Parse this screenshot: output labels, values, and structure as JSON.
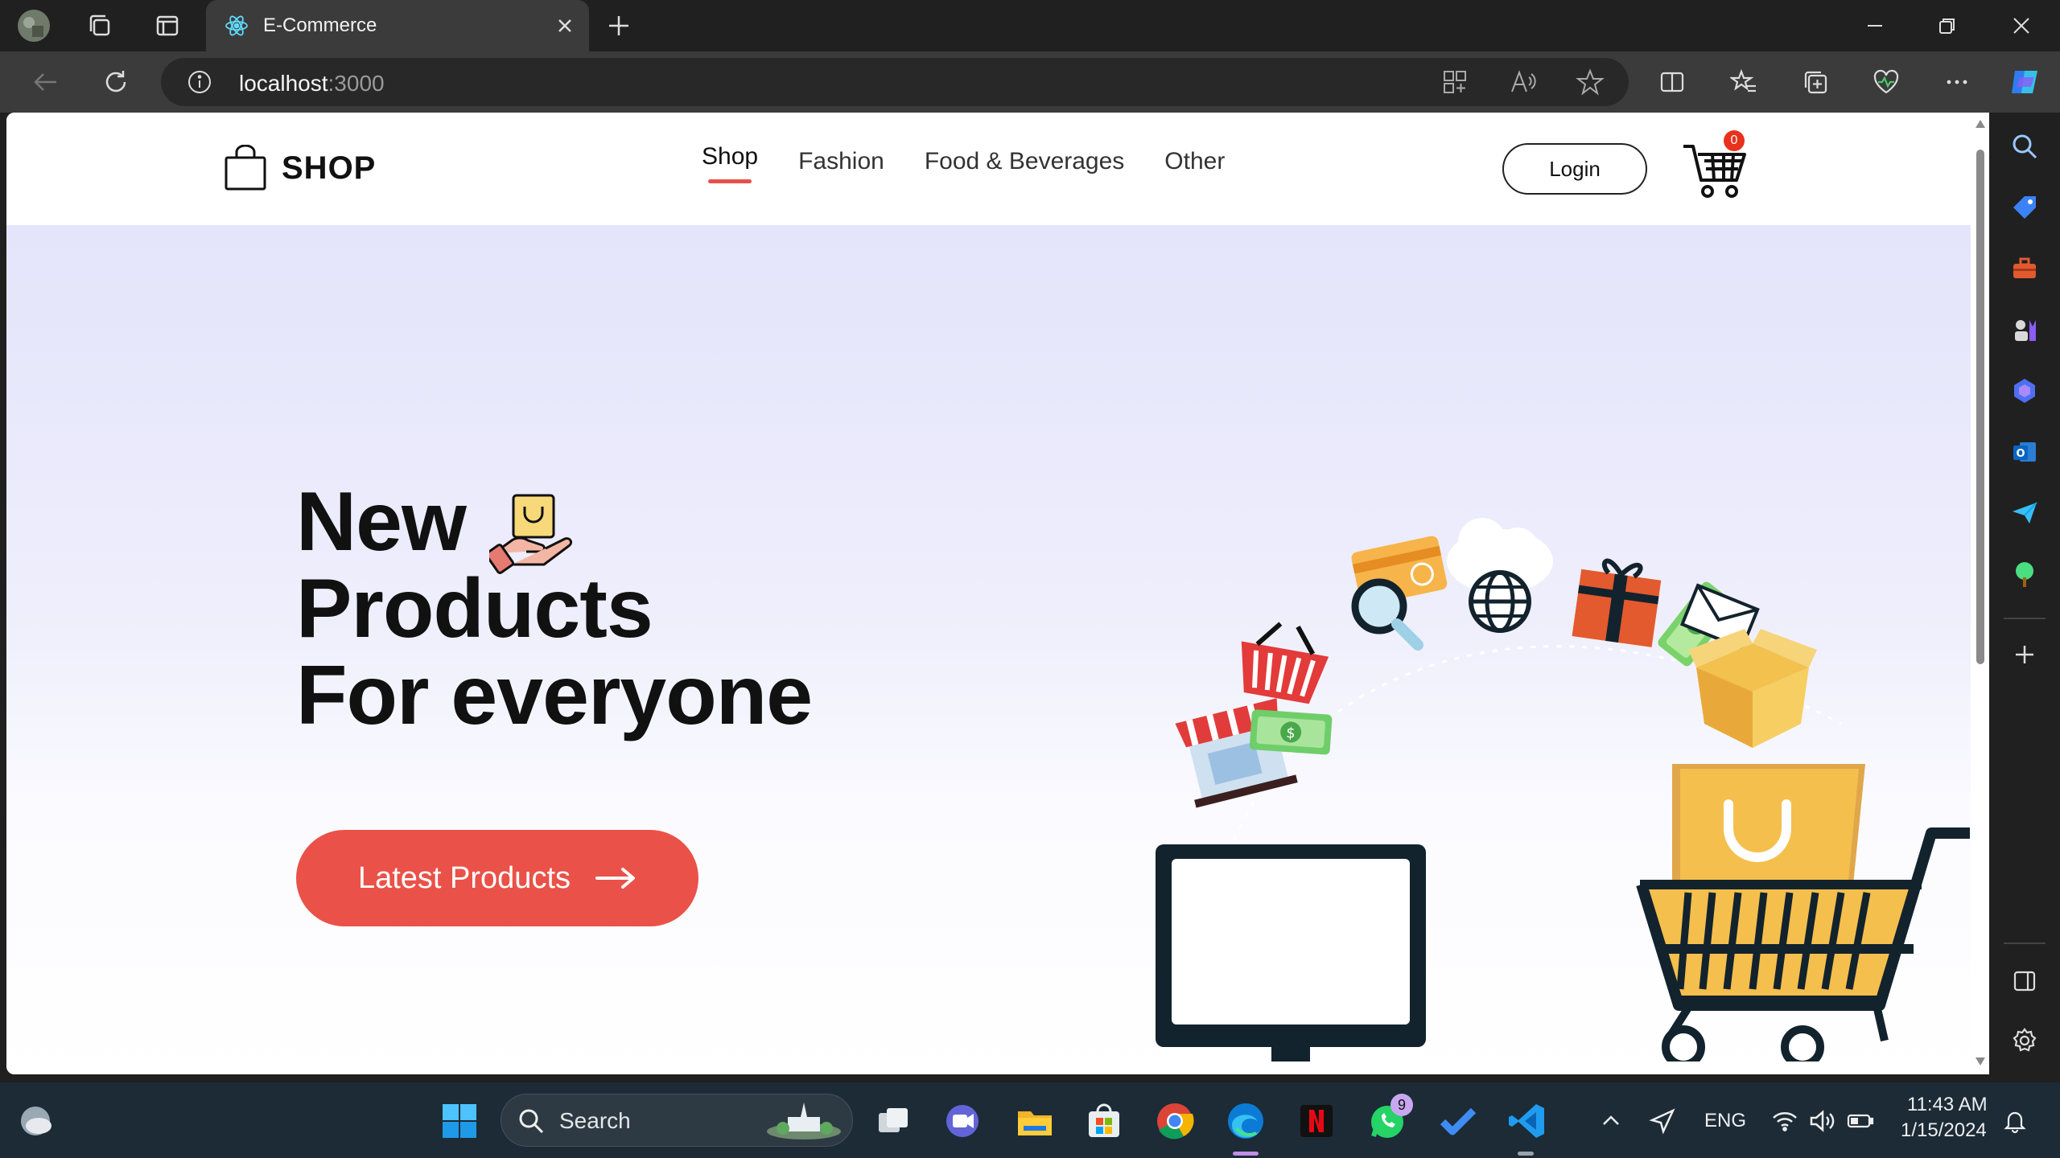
{
  "browser": {
    "tab_title": "E-Commerce",
    "url_host": "localhost",
    "url_port": ":3000"
  },
  "site": {
    "logo_text": "SHOP",
    "nav": [
      {
        "label": "Shop",
        "active": true
      },
      {
        "label": "Fashion",
        "active": false
      },
      {
        "label": "Food & Beverages",
        "active": false
      },
      {
        "label": "Other",
        "active": false
      }
    ],
    "login_label": "Login",
    "cart_count": "0",
    "accent_color": "#ea5148"
  },
  "hero": {
    "line1": "New",
    "line2": "Products",
    "line3": "For everyone",
    "cta_label": "Latest Products"
  },
  "taskbar": {
    "search_label": "Search",
    "whatsapp_badge": "9",
    "language": "ENG",
    "time": "11:43 AM",
    "date": "1/15/2024"
  }
}
